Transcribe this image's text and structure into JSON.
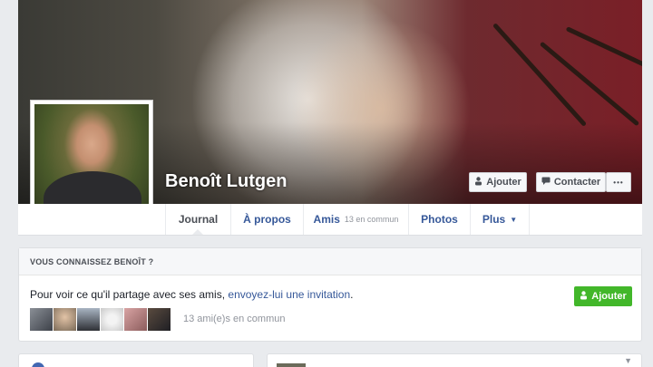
{
  "profile": {
    "name": "Benoît Lutgen"
  },
  "cover_actions": {
    "add_label": "Ajouter",
    "contact_label": "Contacter",
    "more_label": "•••"
  },
  "tabs": [
    {
      "label": "Journal"
    },
    {
      "label": "À propos"
    },
    {
      "label": "Amis",
      "sub": "13 en commun"
    },
    {
      "label": "Photos"
    },
    {
      "label": "Plus",
      "caret": "▼"
    }
  ],
  "know_card": {
    "heading": "VOUS CONNAISSEZ BENOÎT ?",
    "text_before": "Pour voir ce qu'il partage avec ses amis, ",
    "link_text": "envoyez-lui une invitation",
    "text_after": ".",
    "add_label": "Ajouter",
    "mutual_text": "13 ami(e)s en commun"
  },
  "colors": {
    "link": "#365899",
    "green_button": "#42b72a",
    "page_bg": "#e9ebee"
  },
  "icons": {
    "add_friend": "person-plus-icon",
    "message": "message-icon",
    "more": "more-dots-icon"
  }
}
